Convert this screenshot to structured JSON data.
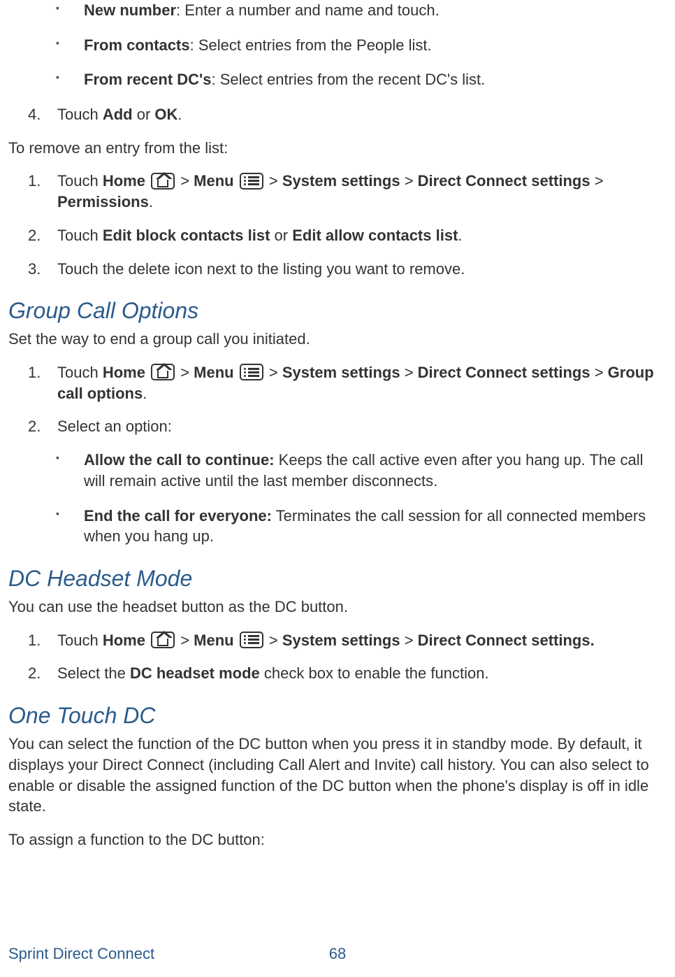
{
  "topBullets": [
    {
      "bold": "New number",
      "rest": ": Enter a number and name and touch."
    },
    {
      "bold": "From contacts",
      "rest": ": Select entries from the People list."
    },
    {
      "bold": "From recent DC's",
      "rest": ": Select entries from the recent DC's list."
    }
  ],
  "step4": {
    "num": "4.",
    "pre": "Touch ",
    "b1": "Add",
    "mid": " or ",
    "b2": "OK",
    "post": "."
  },
  "removeIntro": "To remove an entry from the list:",
  "removeSteps": {
    "s1": {
      "num": "1.",
      "t1": "Touch ",
      "home": "Home",
      "gt1": " > ",
      "menu": "Menu",
      "gt2": " > ",
      "sys": "System settings",
      "gt3": " > ",
      "dc": "Direct Connect settings",
      "gt4": " > ",
      "perm": "Permissions",
      "dot": "."
    },
    "s2": {
      "num": "2.",
      "t1": "Touch ",
      "b1": "Edit block contacts list",
      "mid": " or ",
      "b2": "Edit allow contacts list",
      "dot": "."
    },
    "s3": {
      "num": "3.",
      "text": "Touch the delete icon next to the listing you want to remove."
    }
  },
  "groupCall": {
    "heading": "Group Call Options",
    "lead": "Set the way to end a group call you initiated.",
    "s1": {
      "num": "1.",
      "t1": "Touch ",
      "home": "Home",
      "gt1": " > ",
      "menu": "Menu",
      "gt2": " > ",
      "sys": "System settings",
      "gt3": " > ",
      "dc": "Direct Connect settings",
      "gt4": " > ",
      "group": "Group call options",
      "dot": "."
    },
    "s2": {
      "num": "2.",
      "text": "Select an option:"
    },
    "optA": {
      "bold": "Allow the call to continue:",
      "rest": " Keeps the call active even after you hang up. The call will remain active until the last member disconnects."
    },
    "optB": {
      "bold": "End the call for everyone:",
      "rest": " Terminates the call session for all connected members when you hang up."
    }
  },
  "headset": {
    "heading": "DC Headset Mode",
    "lead": "You can use the headset button as the DC button.",
    "s1": {
      "num": "1.",
      "t1": "Touch ",
      "home": "Home",
      "gt1": " > ",
      "menu": "Menu",
      "gt2": " > ",
      "sys": "System settings",
      "gt3": " > ",
      "dc": "Direct Connect settings."
    },
    "s2": {
      "num": "2.",
      "t1": "Select the ",
      "b1": "DC headset mode",
      "rest": " check box to enable the function."
    }
  },
  "oneTouch": {
    "heading": "One Touch DC",
    "lead": "You can select the function of the DC button when you press it in standby mode. By default, it displays your Direct Connect (including Call Alert and Invite) call history. You can also select to enable or disable the assigned function of the DC button when the phone's display is off in idle state.",
    "assign": "To assign a function to the DC button:"
  },
  "footer": {
    "title": "Sprint Direct Connect",
    "page": "68"
  }
}
